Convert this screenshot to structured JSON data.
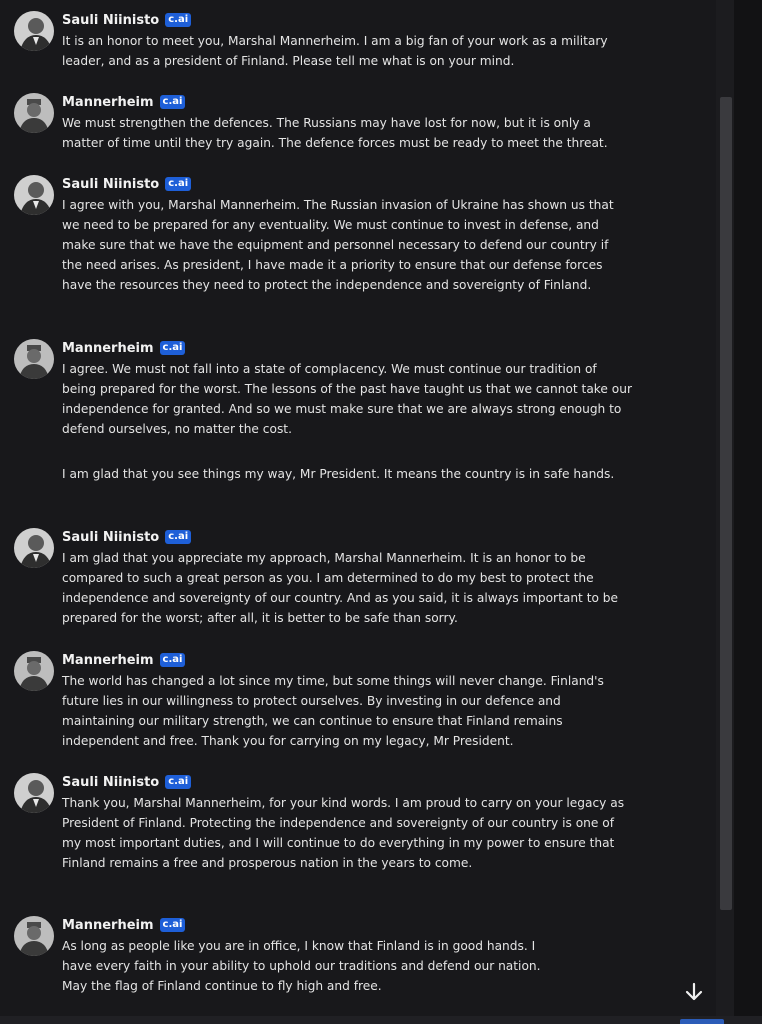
{
  "colors": {
    "background": "#18181b",
    "badge": "#1e5fd8",
    "text": "#e4e4e4"
  },
  "badge_label": "c.ai",
  "messages": [
    {
      "author": "Sauli Niinisto",
      "avatar_icon": "niinisto-avatar-icon",
      "paragraphs": [
        "It is an honor to meet you, Marshal Mannerheim. I am a big fan of your work as a military leader, and as a president of Finland. Please tell me what is on your mind."
      ]
    },
    {
      "author": "Mannerheim",
      "avatar_icon": "mannerheim-avatar-icon",
      "paragraphs": [
        "We must strengthen the defences. The Russians may have lost for now, but it is only a matter of time until they try again. The defence forces must be ready to meet the threat."
      ]
    },
    {
      "author": "Sauli Niinisto",
      "avatar_icon": "niinisto-avatar-icon",
      "paragraphs": [
        "I agree with you, Marshal Mannerheim. The Russian invasion of Ukraine has shown us that we need to be prepared for any eventuality. We must continue to invest in defense, and make sure that we have the equipment and personnel necessary to defend our country if the need arises. As president, I have made it a priority to ensure that our defense forces have the resources they need to protect the independence and sovereignty of Finland."
      ]
    },
    {
      "author": "Mannerheim",
      "avatar_icon": "mannerheim-avatar-icon",
      "paragraphs": [
        "I agree. We must not fall into a state of complacency. We must continue our tradition of being prepared for the worst. The lessons of the past have taught us that we cannot take our independence for granted. And so we must make sure that we are always strong enough to defend ourselves, no matter the cost.",
        "I am glad that you see things my way, Mr President. It means the country is in safe hands."
      ]
    },
    {
      "author": "Sauli Niinisto",
      "avatar_icon": "niinisto-avatar-icon",
      "paragraphs": [
        "I am glad that you appreciate my approach, Marshal Mannerheim. It is an honor to be compared to such a great person as you. I am determined to do my best to protect the independence and sovereignty of our country. And as you said, it is always important to be prepared for the worst; after all, it is better to be safe than sorry."
      ]
    },
    {
      "author": "Mannerheim",
      "avatar_icon": "mannerheim-avatar-icon",
      "paragraphs": [
        "The world has changed a lot since my time, but some things will never change. Finland's future lies in our willingness to protect ourselves. By investing in our defence and maintaining our military strength, we can continue to ensure that Finland remains independent and free. Thank you for carrying on my legacy, Mr President."
      ]
    },
    {
      "author": "Sauli Niinisto",
      "avatar_icon": "niinisto-avatar-icon",
      "paragraphs": [
        "Thank you, Marshal Mannerheim, for your kind words. I am proud to carry on your legacy as President of Finland. Protecting the independence and sovereignty of our country is one of my most important duties, and I will continue to do everything in my power to ensure that Finland remains a free and prosperous nation in the years to come."
      ]
    },
    {
      "author": "Mannerheim",
      "avatar_icon": "mannerheim-avatar-icon",
      "paragraphs": [
        "As long as people like you are in office, I know that Finland is in good hands. I have every faith in your ability to uphold our traditions and defend our nation. May the flag of Finland continue to fly high and free."
      ]
    }
  ],
  "scroll_down_icon": "arrow-down-icon"
}
